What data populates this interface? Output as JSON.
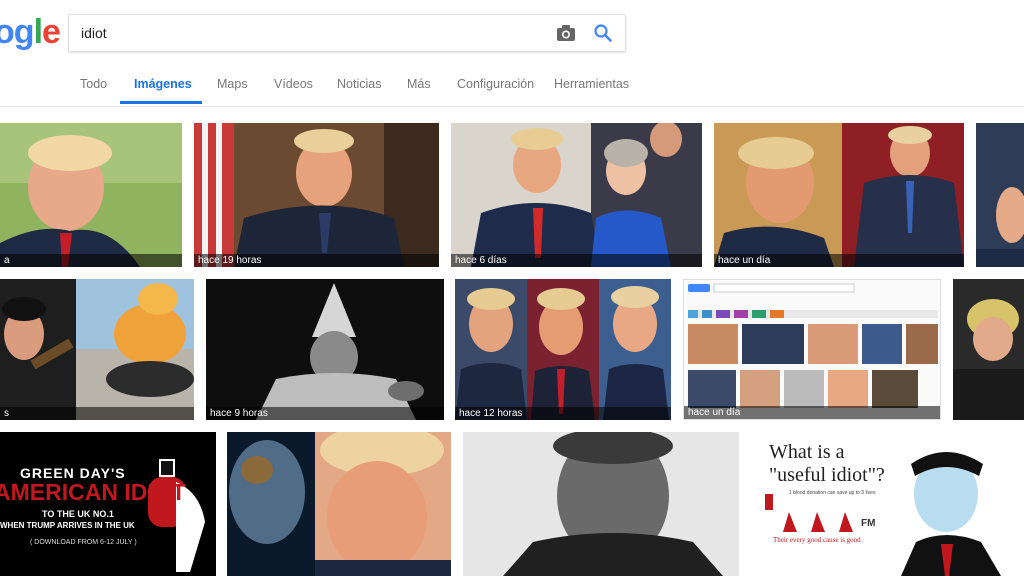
{
  "logo": {
    "parts": [
      "o",
      "g",
      "l",
      "e"
    ]
  },
  "search": {
    "query": "idiot"
  },
  "tabs": [
    {
      "label": "Todo"
    },
    {
      "label": "Imágenes"
    },
    {
      "label": "Maps"
    },
    {
      "label": "Vídeos"
    },
    {
      "label": "Noticias"
    },
    {
      "label": "Más"
    },
    {
      "label": "Configuración"
    },
    {
      "label": "Herramientas"
    }
  ],
  "results": {
    "row1": [
      {
        "caption": "a"
      },
      {
        "caption": "hace 19 horas"
      },
      {
        "caption": "hace 6 días"
      },
      {
        "caption": "hace un día"
      }
    ],
    "row2": [
      {
        "caption": "s"
      },
      {
        "caption": "hace 9 horas"
      },
      {
        "caption": "hace 12 horas"
      },
      {
        "caption": "hace un día"
      }
    ],
    "row3": {
      "green_day": {
        "line1": "GREEN DAY'S",
        "line2": "AMERICAN IDIOT",
        "line3": "TO THE UK NO.1",
        "line4": "WHEN TRUMP ARRIVES IN THE UK",
        "line5": "( DOWNLOAD FROM 6-12 JULY )"
      },
      "useful": {
        "line1": "What is a",
        "line2": "\"useful idiot\"?",
        "small": "1 blood donation can save up to 3 lives",
        "fm": "FM",
        "tagline": "Their every good cause is good"
      }
    }
  },
  "colors": {
    "accent": "#1a73e8",
    "tab_inactive": "#777777"
  }
}
